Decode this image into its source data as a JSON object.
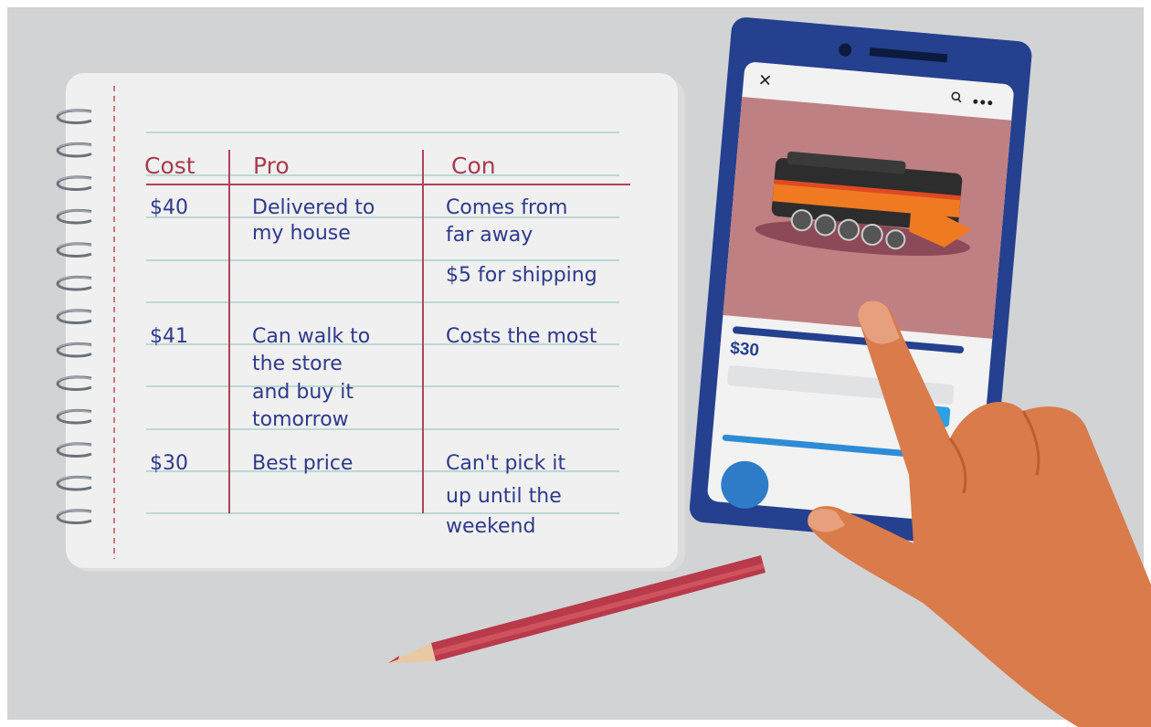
{
  "colors": {
    "background": "#d2d3d5",
    "paper": "#f0f0f0",
    "rule_line": "#9ec9c1",
    "margin_line": "#c54b56",
    "header_line": "#b04356",
    "header_text": "#a93b4e",
    "ink": "#2d3a8c",
    "phone_body": "#24408e",
    "phone_screen": "#f2f2f2",
    "product_bg": "#bf8083",
    "accent_blue": "#2e8bd6",
    "skin": "#d97b4a",
    "pencil": "#b83a4b"
  },
  "notebook": {
    "headers": {
      "cost": "Cost",
      "pro": "Pro",
      "con": "Con"
    },
    "rows": [
      {
        "cost": "$40",
        "pro": [
          "Delivered to",
          "my house"
        ],
        "con": [
          "Comes from",
          "far away"
        ],
        "extra": "$5 for shipping"
      },
      {
        "cost": "$41",
        "pro": [
          "Can walk to",
          "the store",
          "and buy it",
          "tomorrow"
        ],
        "con": [
          "Costs the most"
        ]
      },
      {
        "cost": "$30",
        "pro": [
          "Best price"
        ],
        "con": [
          "Can't pick it",
          "up until the",
          "weekend"
        ]
      }
    ]
  },
  "phone": {
    "close_icon": "close-icon",
    "search_icon": "search-icon",
    "more_icon": "more-icon",
    "price": "$30"
  }
}
